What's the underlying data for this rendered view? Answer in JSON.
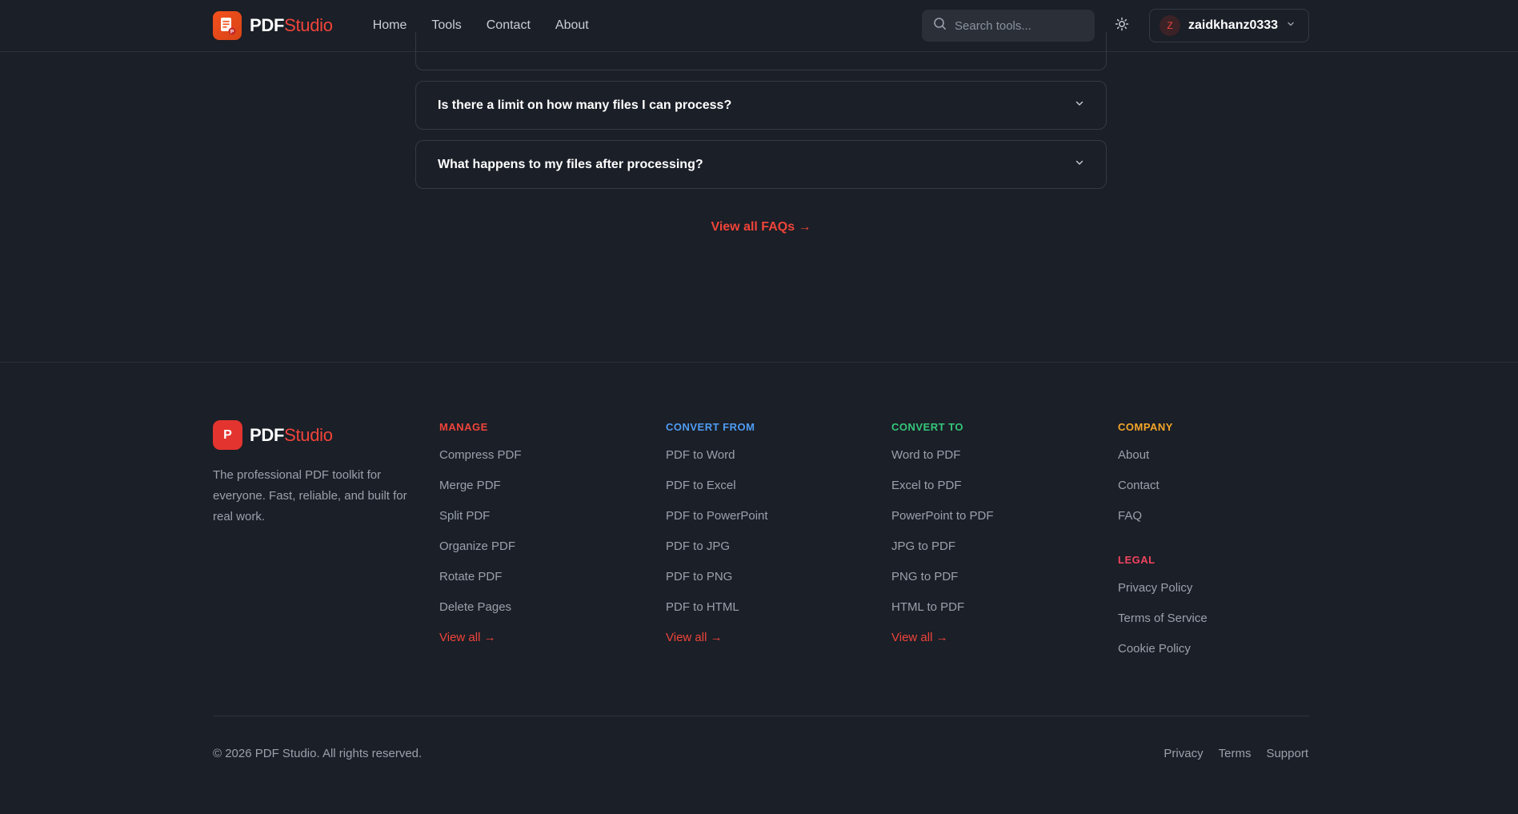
{
  "header": {
    "logo_pdf": "PDF",
    "logo_studio": "Studio",
    "nav": [
      {
        "label": "Home"
      },
      {
        "label": "Tools"
      },
      {
        "label": "Contact"
      },
      {
        "label": "About"
      }
    ],
    "search_placeholder": "Search tools...",
    "user": {
      "initial": "Z",
      "name": "zaidkhanz0333"
    }
  },
  "faq": {
    "items": [
      {
        "question": "Is there a limit on how many files I can process?"
      },
      {
        "question": "What happens to my files after processing?"
      }
    ],
    "view_all": "View all FAQs →"
  },
  "footer": {
    "logo_letter": "P",
    "logo_pdf": "PDF",
    "logo_studio": "Studio",
    "description": "The professional PDF toolkit for everyone. Fast, reliable, and built for real work.",
    "columns": [
      {
        "heading": "MANAGE",
        "color": "#f0443a",
        "links": [
          "Compress PDF",
          "Merge PDF",
          "Split PDF",
          "Organize PDF",
          "Rotate PDF",
          "Delete Pages"
        ],
        "view_all": "View all →"
      },
      {
        "heading": "CONVERT FROM",
        "color": "#4e9cf5",
        "links": [
          "PDF to Word",
          "PDF to Excel",
          "PDF to PowerPoint",
          "PDF to JPG",
          "PDF to PNG",
          "PDF to HTML"
        ],
        "view_all": "View all →"
      },
      {
        "heading": "CONVERT TO",
        "color": "#34c77b",
        "links": [
          "Word to PDF",
          "Excel to PDF",
          "PowerPoint to PDF",
          "JPG to PDF",
          "PNG to PDF",
          "HTML to PDF"
        ],
        "view_all": "View all →"
      },
      {
        "heading": "COMPANY",
        "color": "#f4a62a",
        "links": [
          "About",
          "Contact",
          "FAQ"
        ]
      }
    ],
    "legal": {
      "heading": "LEGAL",
      "color": "#f2445f",
      "links": [
        "Privacy Policy",
        "Terms of Service",
        "Cookie Policy"
      ]
    },
    "copyright": "© 2026 PDF Studio. All rights reserved.",
    "bottom_links": [
      "Privacy",
      "Terms",
      "Support"
    ]
  },
  "colors": {
    "background": "#1b1f27",
    "accent": "#f0443a"
  }
}
